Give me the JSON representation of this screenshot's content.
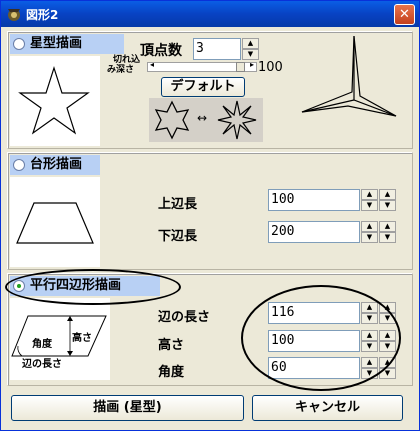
{
  "window": {
    "title": "図形2",
    "close_glyph": "✕"
  },
  "star": {
    "label": "星型描画",
    "selected": false,
    "vertex_label": "頂点数",
    "vertex_value": "3",
    "cut_depth_label_1": "切れ込",
    "cut_depth_label_2": "み深さ",
    "cut_depth_value": "100",
    "slider_level": 1.0,
    "default_button": "デフォルト",
    "arrow_glyph": "↔"
  },
  "trapezoid": {
    "label": "台形描画",
    "selected": false,
    "upper_label": "上辺長",
    "upper_value": "100",
    "lower_label": "下辺長",
    "lower_value": "200"
  },
  "parallelogram": {
    "label": "平行四辺形描画",
    "selected": true,
    "side_label": "辺の長さ",
    "side_value": "116",
    "height_label": "高さ",
    "height_value": "100",
    "angle_label": "角度",
    "angle_value": "60",
    "diagram_angle": "角度",
    "diagram_height": "高さ",
    "diagram_side": "辺の長さ"
  },
  "footer": {
    "draw_button": "描画 (星型)",
    "cancel_button": "キャンセル"
  }
}
